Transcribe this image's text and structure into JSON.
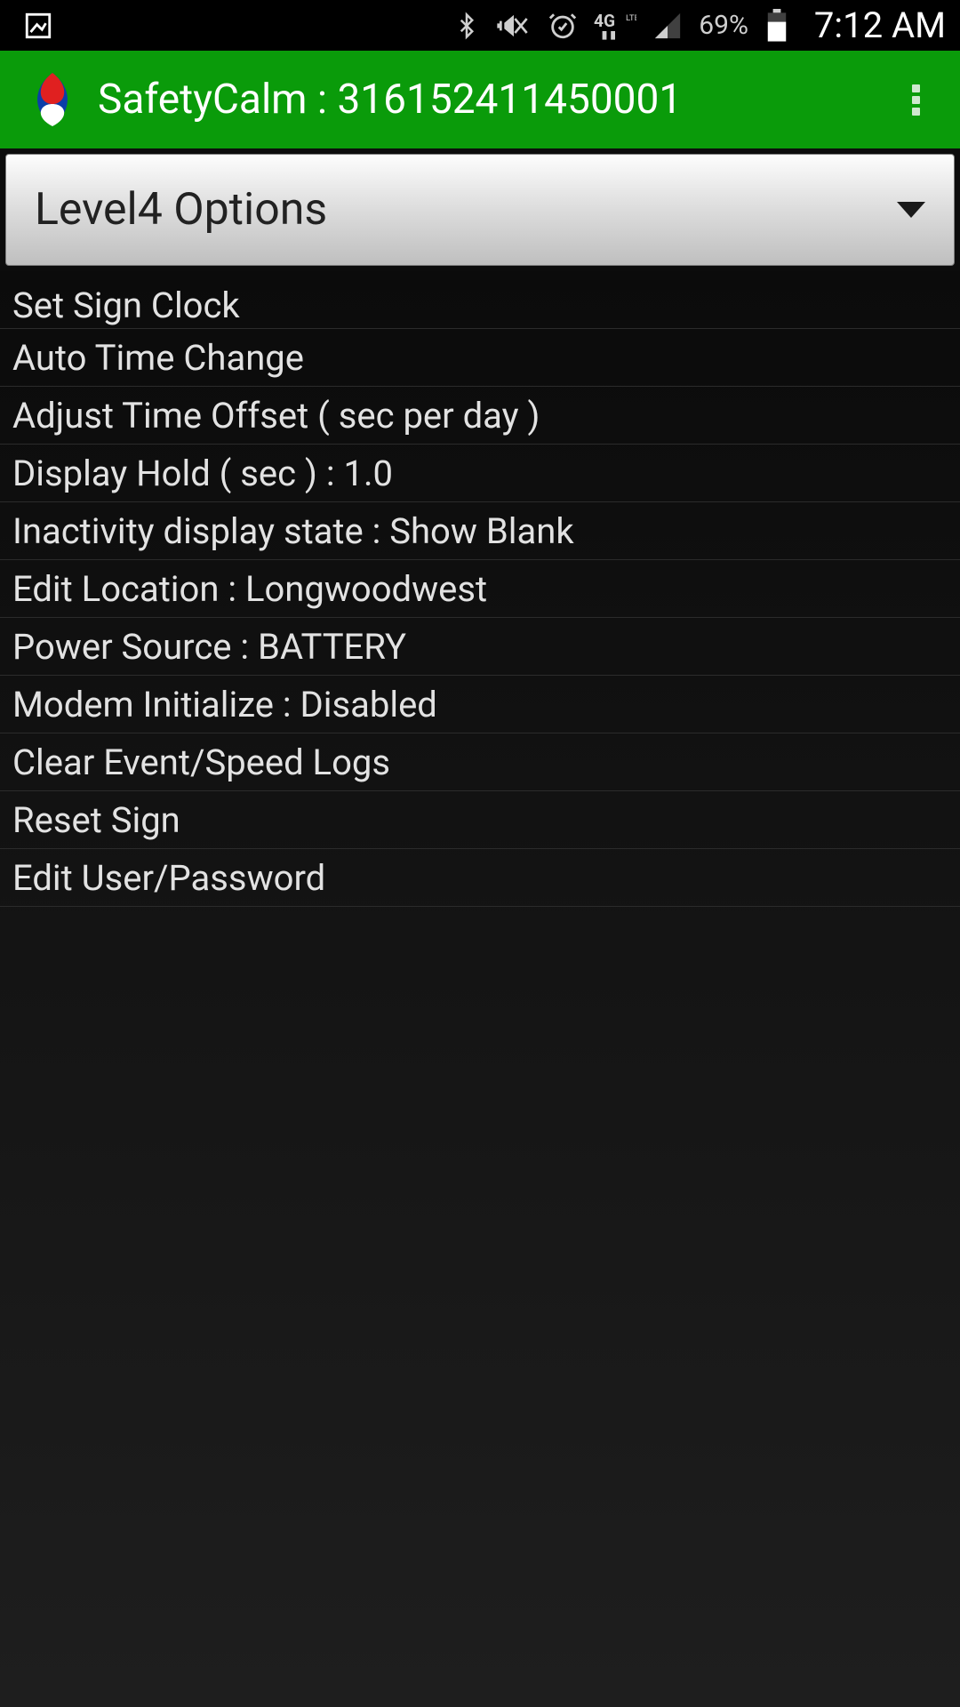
{
  "status": {
    "battery_pct": "69%",
    "time": "7:12 AM"
  },
  "appbar": {
    "title": "SafetyCalm : 316152411450001"
  },
  "spinner": {
    "selected": "Level4 Options"
  },
  "options": [
    {
      "label": "Set Sign Clock"
    },
    {
      "label": "Auto Time Change"
    },
    {
      "label": "Adjust Time Offset ( sec per day )"
    },
    {
      "label": "Display Hold ( sec ) : 1.0"
    },
    {
      "label": "Inactivity display state : Show Blank"
    },
    {
      "label": "Edit Location : Longwoodwest"
    },
    {
      "label": "Power Source : BATTERY"
    },
    {
      "label": "Modem Initialize : Disabled"
    },
    {
      "label": "Clear Event/Speed Logs"
    },
    {
      "label": "Reset Sign"
    },
    {
      "label": "Edit User/Password"
    }
  ]
}
